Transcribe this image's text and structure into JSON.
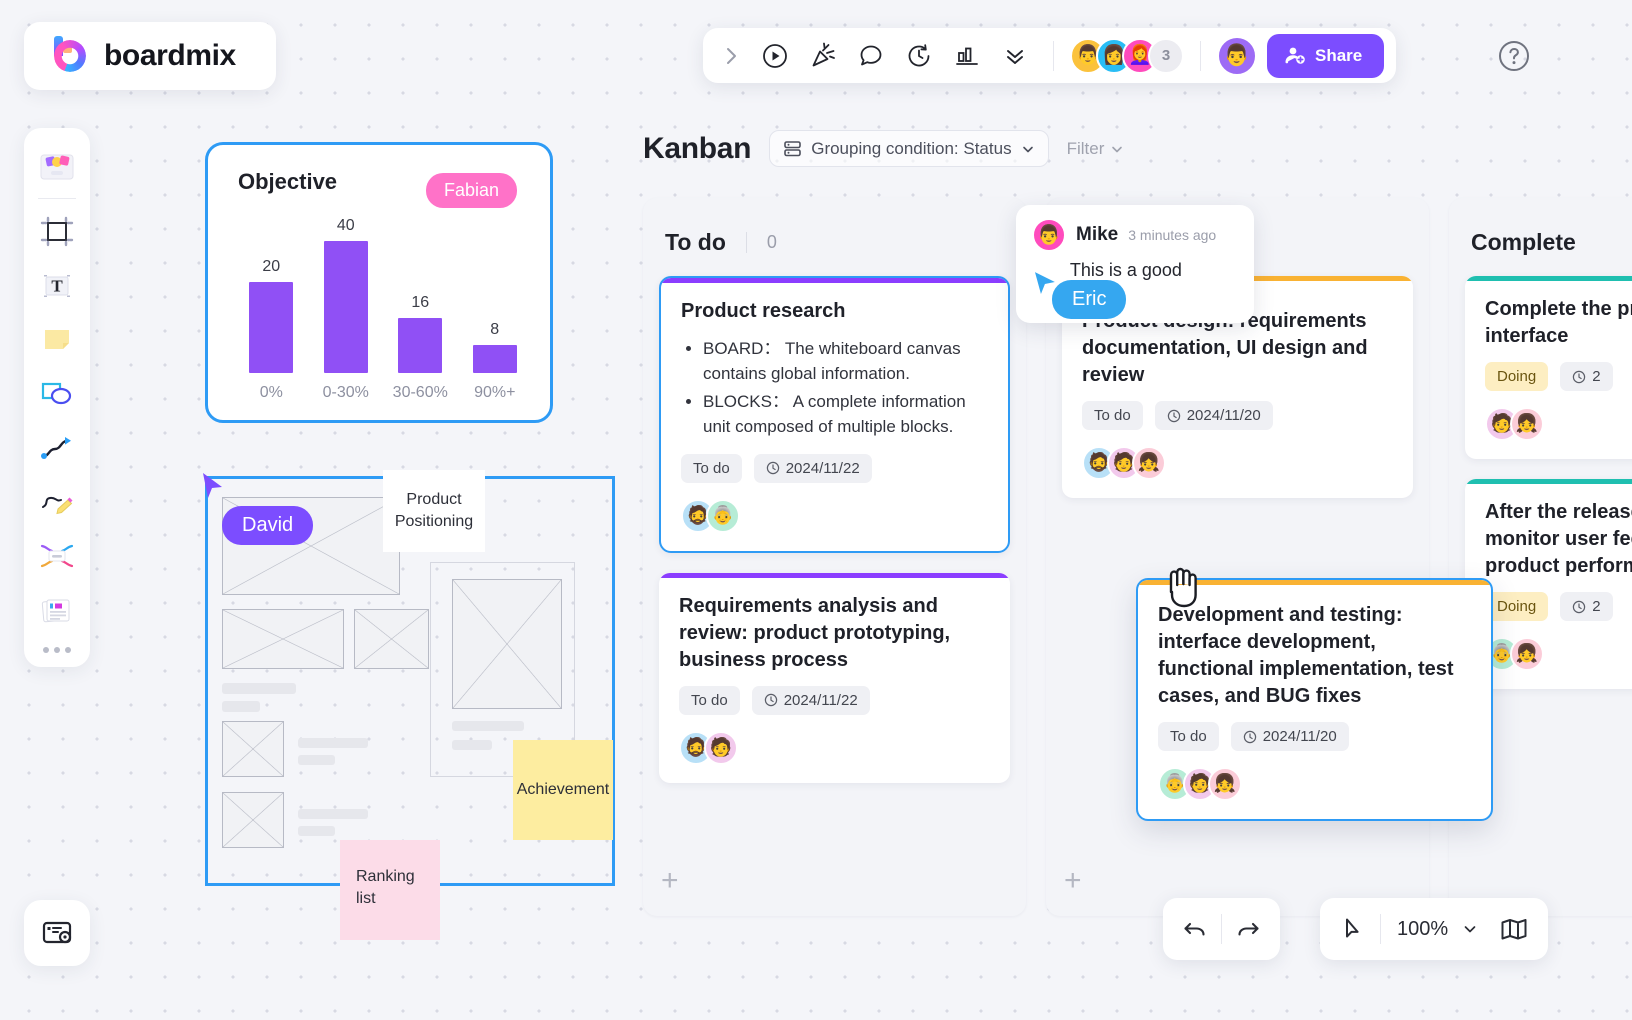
{
  "app": {
    "logo_text": "boardmix",
    "logo_icon": "boardmix-logo-icon"
  },
  "topbar": {
    "expand_icon": "chevron-right-icon",
    "buttons": [
      {
        "icon": "play-circle-icon",
        "name": "present-button"
      },
      {
        "icon": "party-popper-icon",
        "name": "celebrate-button"
      },
      {
        "icon": "chat-bubble-icon",
        "name": "comment-button"
      },
      {
        "icon": "timer-icon",
        "name": "timer-button"
      },
      {
        "icon": "bar-chart-icon",
        "name": "vote-button"
      },
      {
        "icon": "chevrons-down-icon",
        "name": "more-tools-button"
      }
    ],
    "collaborators": [
      {
        "name": "collab-avatar-1",
        "bg": "#fbc23c",
        "glyph": "👨"
      },
      {
        "name": "collab-avatar-2",
        "bg": "#29bdf5",
        "glyph": "👩"
      },
      {
        "name": "collab-avatar-3",
        "bg": "#ff4bbd",
        "glyph": "👩‍🦰"
      }
    ],
    "overflow_count": "3",
    "self_avatar": {
      "bg": "#9d6bf5",
      "glyph": "👨"
    },
    "share_label": "Share",
    "share_icon": "person-add-icon",
    "share_color": "#7c4dff",
    "help_icon": "question-circle-icon"
  },
  "rail": {
    "items": [
      {
        "name": "sidebar-item-templates",
        "icon": "template-gallery-icon"
      },
      {
        "name": "sidebar-item-frame",
        "icon": "frame-icon"
      },
      {
        "name": "sidebar-item-text",
        "icon": "text-icon"
      },
      {
        "name": "sidebar-item-sticky-note",
        "icon": "sticky-note-icon"
      },
      {
        "name": "sidebar-item-shapes",
        "icon": "shapes-icon"
      },
      {
        "name": "sidebar-item-connector",
        "icon": "connector-arrow-icon"
      },
      {
        "name": "sidebar-item-pen",
        "icon": "pencil-draw-icon"
      },
      {
        "name": "sidebar-item-mindmap",
        "icon": "mind-map-icon"
      },
      {
        "name": "sidebar-item-document",
        "icon": "document-icon"
      },
      {
        "name": "sidebar-item-more",
        "icon": "more-dots-icon"
      }
    ],
    "bottom_item": {
      "name": "sidebar-item-minimap",
      "icon": "board-note-icon"
    }
  },
  "objective_card": {
    "title": "Objective",
    "cursor_label": "Fabian",
    "cursor_color": "#ff72c8",
    "border_color": "#2e9bf5"
  },
  "chart_data": {
    "type": "bar",
    "title": "Objective",
    "categories": [
      "0%",
      "0-30%",
      "30-60%",
      "90%+"
    ],
    "values": [
      20,
      40,
      16,
      8
    ],
    "xlabel": "",
    "ylabel": "",
    "ylim": [
      0,
      40
    ],
    "grid": false,
    "legend": "none",
    "bar_color": "#9050f5",
    "data_labels": [
      "20",
      "40",
      "16",
      "8"
    ]
  },
  "wireframe": {
    "cursor_label": "David",
    "cursor_color": "#7c4dff",
    "border_color": "#2e9bf5",
    "notes": [
      {
        "name": "note-product-positioning",
        "text": "Product Positioning",
        "color": "#ffffff"
      },
      {
        "name": "note-achievement",
        "text": "Achievement",
        "color": "#fdeda0"
      },
      {
        "name": "note-ranking-list",
        "text": "Ranking list",
        "color": "#fcdce8"
      }
    ]
  },
  "kanban": {
    "title": "Kanban",
    "grouping_label": "Grouping condition: Status",
    "grouping_icon": "grouping-rows-icon",
    "grouping_chevron": "chevron-down-icon",
    "filter_label": "Filter",
    "filter_chevron": "chevron-down-icon",
    "add_label": "+",
    "columns": [
      {
        "name": "To do",
        "count": "0",
        "cards": [
          {
            "title": "Product research",
            "accent": "purple",
            "selected": true,
            "bullets": [
              "BOARD： The whiteboard canvas contains global information.",
              "BLOCKS： A complete information unit composed of multiple blocks."
            ],
            "status": "To do",
            "date": "2024/11/22",
            "avatars": [
              {
                "bg": "#b8e0f7",
                "glyph": "🧔"
              },
              {
                "bg": "#b6ecd6",
                "glyph": "👵"
              }
            ]
          },
          {
            "title": "Requirements analysis and review: product prototyping, business process",
            "accent": "purple",
            "selected": false,
            "bullets": [],
            "status": "To do",
            "date": "2024/11/22",
            "avatars": [
              {
                "bg": "#b8e0f7",
                "glyph": "🧔"
              },
              {
                "bg": "#f2c9ec",
                "glyph": "🧑"
              }
            ]
          }
        ]
      },
      {
        "name": "",
        "count": "",
        "cards": [
          {
            "title": "Product design: requirements documentation, UI design and review",
            "accent": "orange",
            "selected": false,
            "bullets": [],
            "status": "To do",
            "date": "2024/11/20",
            "avatars": [
              {
                "bg": "#b8e0f7",
                "glyph": "🧔"
              },
              {
                "bg": "#f2c9ec",
                "glyph": "🧑"
              },
              {
                "bg": "#fbccd8",
                "glyph": "👧"
              }
            ]
          }
        ]
      },
      {
        "name": "Complete",
        "count": "",
        "cards": [
          {
            "title": "Complete the product and interface",
            "accent": "teal",
            "selected": false,
            "bullets": [],
            "status": "Doing",
            "date": "2",
            "avatars": [
              {
                "bg": "#f2c9ec",
                "glyph": "🧑"
              },
              {
                "bg": "#fbccd8",
                "glyph": "👧"
              }
            ]
          },
          {
            "title": "After the release of the version, monitor user feedback and product performance",
            "accent": "teal",
            "selected": false,
            "bullets": [],
            "status": "Doing",
            "date": "2",
            "avatars": [
              {
                "bg": "#b6ecd6",
                "glyph": "👵"
              },
              {
                "bg": "#fbccd8",
                "glyph": "👧"
              }
            ]
          }
        ]
      }
    ],
    "floating_card": {
      "title": "Development and testing: interface development, functional implementation, test cases, and BUG fixes",
      "status": "To do",
      "date": "2024/11/20",
      "accent": "orange",
      "avatars": [
        {
          "bg": "#b6ecd6",
          "glyph": "👵"
        },
        {
          "bg": "#f2c9ec",
          "glyph": "🧑"
        },
        {
          "bg": "#fbccd8",
          "glyph": "👧"
        }
      ]
    }
  },
  "comment": {
    "author": "Mike",
    "time": "3 minutes ago",
    "text": "This is a good idea！",
    "avatar": {
      "bg": "#ff4bbd",
      "glyph": "👨"
    },
    "cursor_label": "Eric",
    "cursor_color": "#35a7f0"
  },
  "bottom_bar": {
    "undo_icon": "undo-icon",
    "redo_icon": "redo-icon",
    "pointer_icon": "cursor-pointer-icon",
    "zoom_level": "100%",
    "zoom_chevron": "chevron-down-icon",
    "minimap_icon": "minimap-icon"
  }
}
